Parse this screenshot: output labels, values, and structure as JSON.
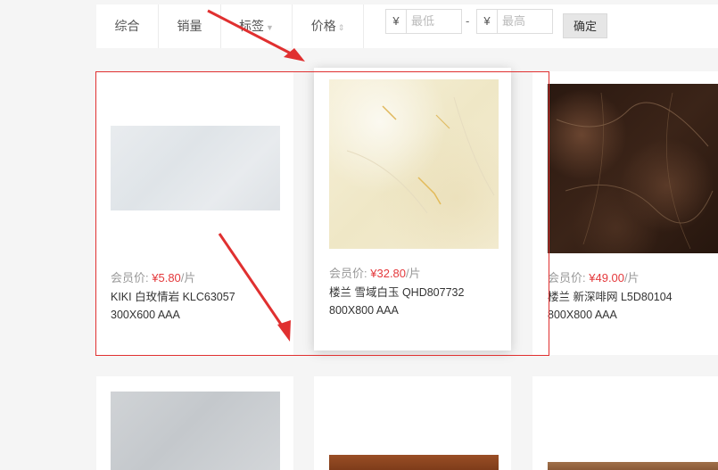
{
  "filter": {
    "sort_items": [
      "综合",
      "销量",
      "标签",
      "价格"
    ],
    "min_symbol": "¥",
    "min_placeholder": "最低",
    "range_dash": "-",
    "max_symbol": "¥",
    "max_placeholder": "最高",
    "confirm_label": "确定"
  },
  "products": [
    {
      "price_label": "会员价:",
      "price_amount": "¥5.80",
      "price_unit": "/片",
      "title_line1": "KIKI 白玫情岩 KLC63057",
      "title_line2": "300X600 AAA"
    },
    {
      "price_label": "会员价:",
      "price_amount": "¥32.80",
      "price_unit": "/片",
      "title_line1": "楼兰 雪域白玉 QHD807732",
      "title_line2": "800X800 AAA"
    },
    {
      "price_label": "会员价:",
      "price_amount": "¥49.00",
      "price_unit": "/片",
      "title_line1": "楼兰 新深啡网 L5D80104",
      "title_line2": "800X800 AAA"
    }
  ],
  "colors": {
    "accent_price": "#e4393c",
    "annotation_red": "#e03030"
  }
}
